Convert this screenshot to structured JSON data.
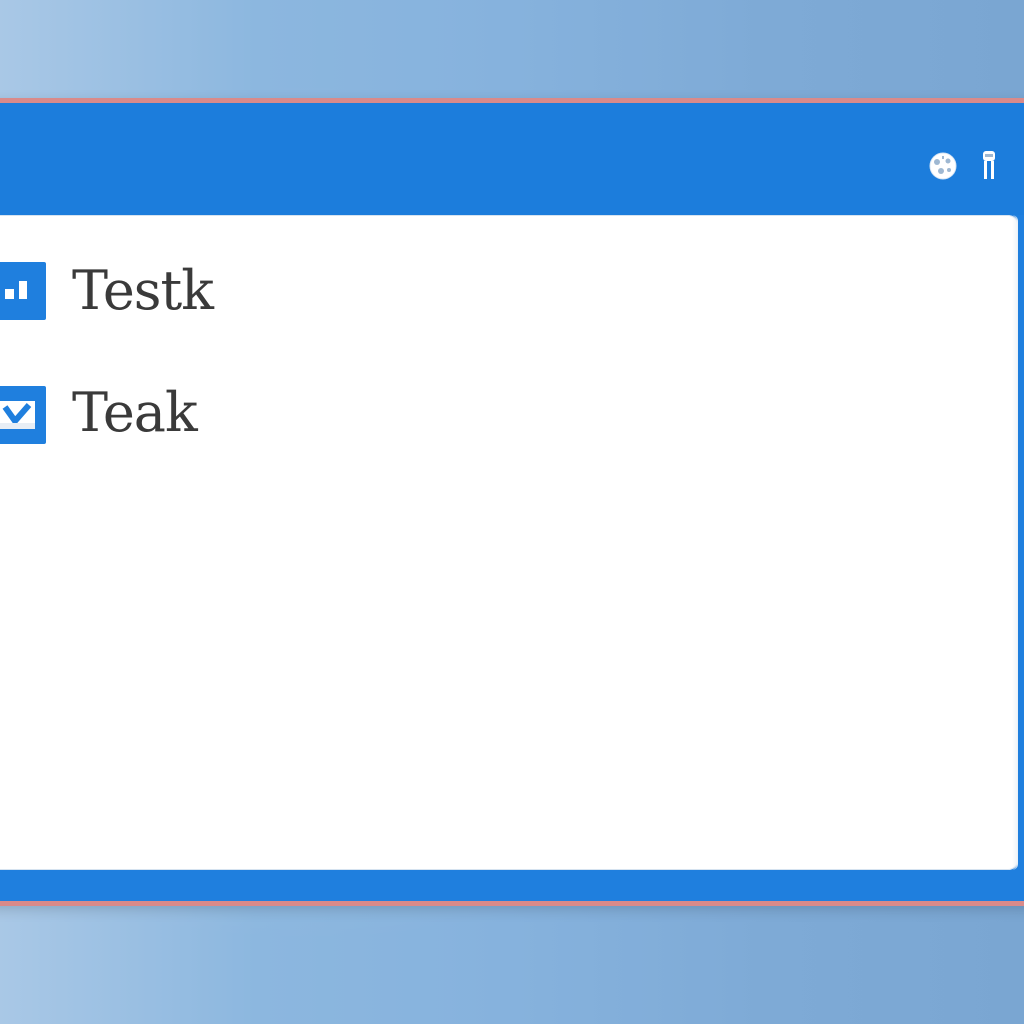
{
  "window": {
    "titlebar": {
      "icons": [
        "globe-icon",
        "pin-icon"
      ]
    }
  },
  "tasks": [
    {
      "label": "Testk",
      "checked": false,
      "icon": "partial-check-icon"
    },
    {
      "label": "Teak",
      "checked": true,
      "icon": "checkmark-icon"
    }
  ],
  "colors": {
    "accent": "#1f7fde",
    "window_border": "#d98a8a",
    "content_bg": "#ffffff",
    "text": "#3a3a3a"
  }
}
